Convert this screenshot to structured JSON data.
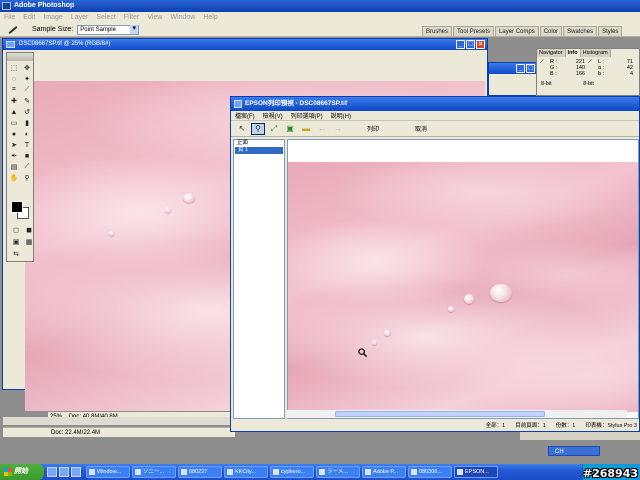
{
  "app": {
    "title": "Adobe Photoshop",
    "menu": [
      "File",
      "Edit",
      "Image",
      "Layer",
      "Select",
      "Filter",
      "View",
      "Window",
      "Help"
    ]
  },
  "options": {
    "sample_label": "Sample Size:",
    "sample_value": "Point Sample"
  },
  "palette_well": [
    "Brushes",
    "Tool Presets",
    "Layer Comps",
    "Color",
    "Swatches",
    "Styles"
  ],
  "doc": {
    "title": "DSC08667SP.tif @ 25% (RGB/8#)",
    "status": "Doc: 22.4M/22.4M"
  },
  "doc2": {
    "zoom": "25%",
    "status": "Doc: 40.8M/40.8M"
  },
  "info": {
    "tabs": [
      "Navigator",
      "Info",
      "Histogram"
    ],
    "rows": [
      {
        "k1": "R :",
        "v1": "221",
        "k2": "L :",
        "v2": "71"
      },
      {
        "k1": "G :",
        "v1": "140",
        "k2": "a :",
        "v2": "42"
      },
      {
        "k1": "B :",
        "v1": "166",
        "k2": "b :",
        "v2": "4"
      }
    ],
    "bits1": "8-bit",
    "bits2": "8-bit"
  },
  "epson": {
    "title": "EPSON列印預視 - DSC08667SP.tif",
    "menu": [
      "檔案(F)",
      "檢視(V)",
      "列印選項(P)",
      "說明(H)"
    ],
    "print_button": "列印",
    "cancel_button": "取消",
    "pages_header": "正面",
    "page_item": "頁 1",
    "status": {
      "total": "全部：1",
      "current": "目前頁面：1",
      "copies": "份數：1",
      "printer": "印表機：Stylus Pro 3"
    }
  },
  "taskbar": {
    "start": "開始",
    "tasks": [
      "Window...",
      "ソニー...",
      "080227",
      "KKCity...",
      "cyphero...",
      "ラーメ...",
      "Adobe P...",
      "080306...",
      "EPSON..."
    ],
    "active_index": 8
  },
  "lang": "CH",
  "watermark": "#268943"
}
